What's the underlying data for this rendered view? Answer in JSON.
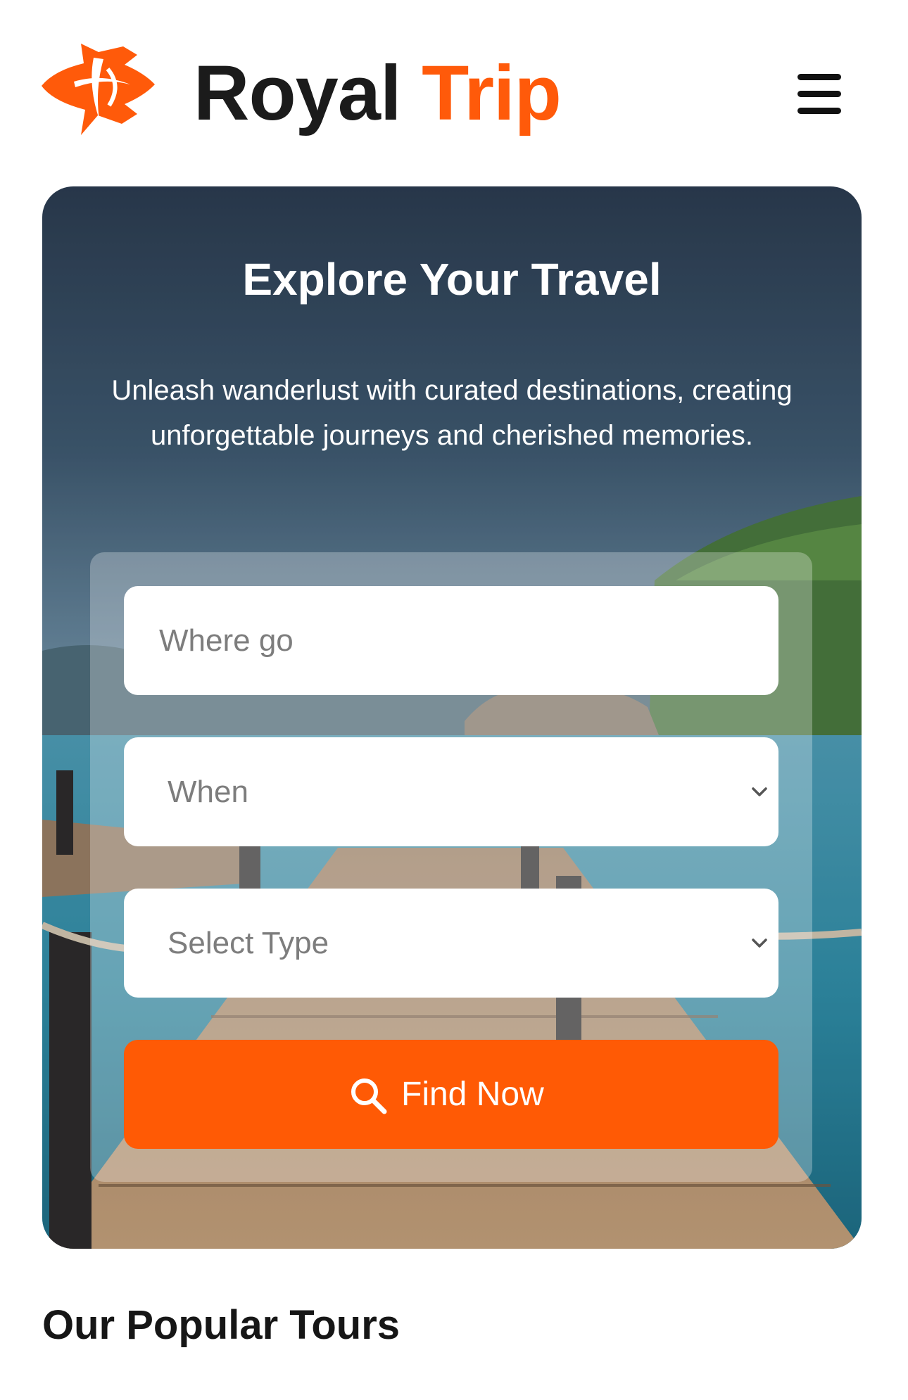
{
  "header": {
    "brand_word1": "Royal",
    "brand_word2": "Trip",
    "logo_icon": "airplane-globe-logo",
    "menu_icon": "hamburger-menu-icon"
  },
  "hero": {
    "title": "Explore Your Travel",
    "subtitle": "Unleash wanderlust with curated destinations, creating unforgettable journeys and cherished memories.",
    "background_icon": "beach-pier-photo"
  },
  "search": {
    "where_placeholder": "Where go",
    "when_label": "When",
    "type_label": "Select Type",
    "find_label": "Find Now",
    "chevron_icon": "chevron-down-icon",
    "search_icon": "search-icon"
  },
  "popular": {
    "title": "Our Popular Tours"
  },
  "colors": {
    "accent": "#ff5a0a",
    "text_dark": "#1b1b1b"
  }
}
